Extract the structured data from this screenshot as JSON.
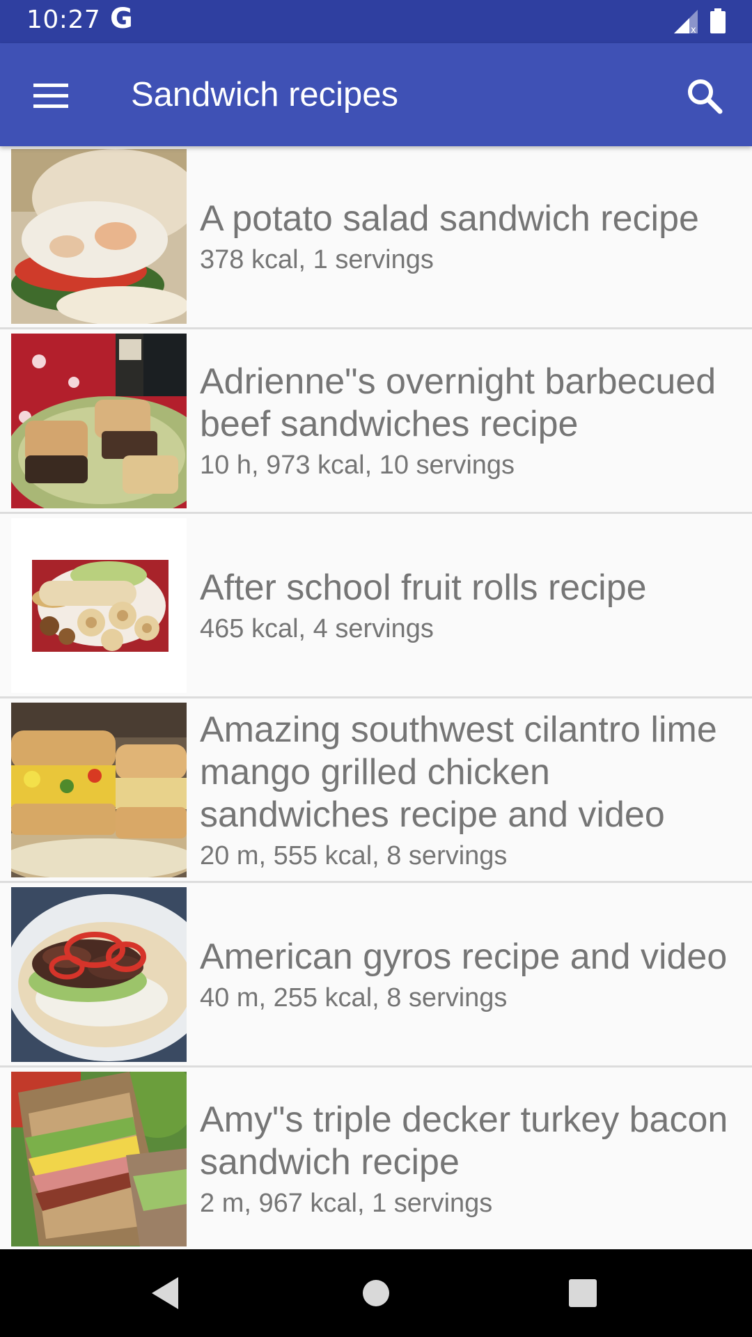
{
  "status_bar": {
    "time": "10:27",
    "app_indicator": "G",
    "icons": [
      "signal-icon",
      "battery-icon"
    ]
  },
  "app_bar": {
    "title": "Sandwich recipes",
    "menu_icon": "menu-icon",
    "search_icon": "search-icon",
    "color": "#3f51b5",
    "status_color": "#2f3fa0"
  },
  "recipes": [
    {
      "title": "A potato salad sandwich recipe",
      "meta": "378 kcal, 1 servings"
    },
    {
      "title": "Adrienne\"s overnight barbecued beef sandwiches recipe",
      "meta": "10 h, 973 kcal, 10 servings"
    },
    {
      "title": "After school fruit rolls recipe",
      "meta": "465 kcal, 4 servings"
    },
    {
      "title": "Amazing southwest cilantro lime mango grilled chicken sandwiches recipe and video",
      "meta": "20 m, 555 kcal, 8 servings"
    },
    {
      "title": "American gyros recipe and video",
      "meta": "40 m, 255 kcal, 8 servings"
    },
    {
      "title": "Amy\"s triple decker turkey bacon sandwich recipe",
      "meta": "2 m, 967 kcal, 1 servings"
    }
  ],
  "nav_bar": {
    "icons": [
      "back-icon",
      "home-icon",
      "recents-icon"
    ]
  }
}
